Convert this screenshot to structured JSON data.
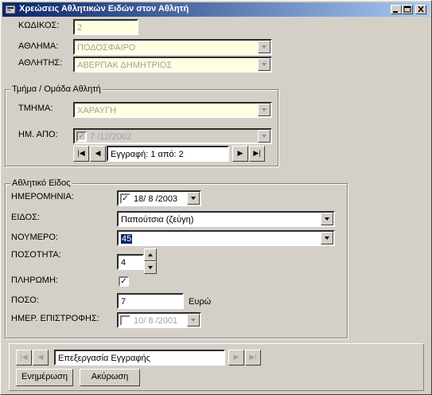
{
  "window": {
    "title": "Χρεώσεις Αθλητικών Ειδών στον Αθλητή",
    "buttons": {
      "minimize": "_",
      "maximize": "□",
      "close": "×"
    }
  },
  "top": {
    "code_label": "ΚΩΔΙΚΟΣ:",
    "code_value": "2",
    "sport_label": "ΑΘΛΗΜΑ:",
    "sport_value": "ΠΟΔΟΣΦΑΙΡΟ",
    "athlete_label": "ΑΘΛΗΤΗΣ:",
    "athlete_value": "ΑΒΕΡΠΑΚ ΔΗΜΗΤΡΙΟΣ"
  },
  "group1": {
    "title": "Τμήμα / Ομάδα Αθλητή",
    "dept_label": "ΤΜΗΜΑ:",
    "dept_value": "ΧΑΡΑΥΓΗ",
    "from_label": "ΗΜ. ΑΠΟ:",
    "from_value": "7 /12/2002",
    "from_checked": true,
    "nav_text": "Εγγραφή: 1 από: 2"
  },
  "group2": {
    "title": "Αθλητικό Είδος",
    "date_label": "ΗΜΕΡΟΜΗΝΙΑ:",
    "date_value": "18/ 8 /2003",
    "date_checked": true,
    "item_label": "ΕΙΔΟΣ:",
    "item_value": "Παπούτσια (ζεύγη)",
    "size_label": "ΝΟΥΜΕΡΟ:",
    "size_value": "45",
    "qty_label": "ΠΟΣΟΤΗΤΑ:",
    "qty_value": "4",
    "paid_label": "ΠΛΗΡΩΜΗ:",
    "paid_checked": true,
    "amount_label": "ΠΟΣΟ:",
    "amount_value": "7",
    "currency": "Ευρώ",
    "return_label": "ΗΜΕΡ. ΕΠΙΣΤΡΟΦΗΣ:",
    "return_value": "10/ 8 /2001",
    "return_checked": false
  },
  "bottom": {
    "nav_text": "Επεξεργασία Εγγραφής",
    "update_label": "Ενημέρωση",
    "cancel_label": "Ακύρωση"
  },
  "icons": {
    "first": "|◀",
    "prev": "◀",
    "next": "▶",
    "last": "▶|",
    "check": "✓"
  }
}
